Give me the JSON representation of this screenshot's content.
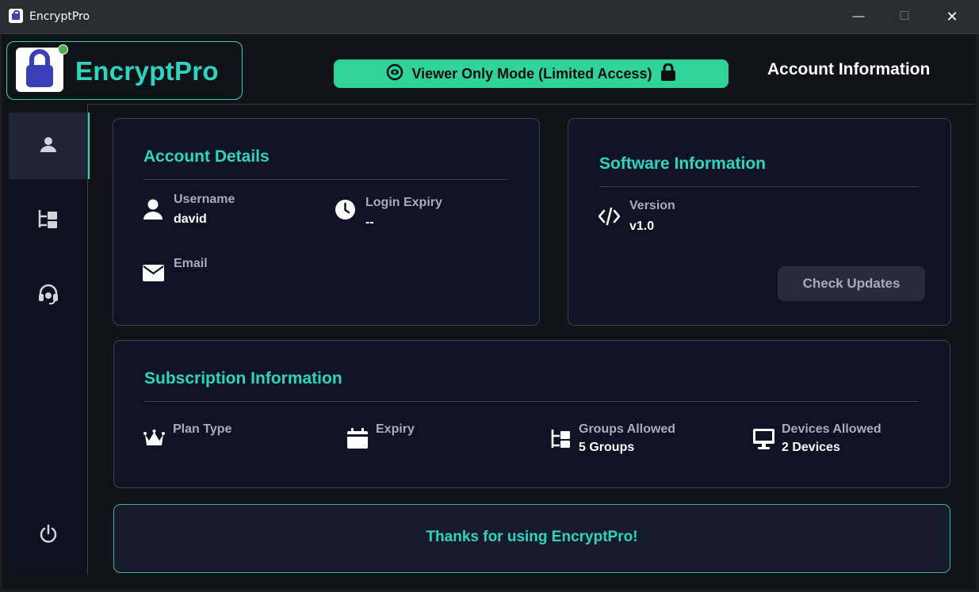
{
  "window": {
    "title": "EncryptPro",
    "minimize_glyph": "—",
    "maximize_glyph": "☐",
    "close_glyph": "✕"
  },
  "header": {
    "logo_text": "EncryptPro",
    "mode_banner": "Viewer Only Mode (Limited Access)",
    "page_heading": "Account Information"
  },
  "sidebar": {
    "items": [
      {
        "icon": "user-icon",
        "active": true
      },
      {
        "icon": "groups-icon",
        "active": false
      },
      {
        "icon": "support-headset-icon",
        "active": false
      }
    ],
    "bottom_icon": "power-icon"
  },
  "account_details": {
    "title": "Account Details",
    "username_label": "Username",
    "username_value": "david",
    "login_expiry_label": "Login Expiry",
    "login_expiry_value": "--",
    "email_label": "Email",
    "email_value": ""
  },
  "software_info": {
    "title": "Software Information",
    "version_label": "Version",
    "version_value": "v1.0",
    "check_updates_label": "Check Updates"
  },
  "subscription": {
    "title": "Subscription Information",
    "plan_label": "Plan Type",
    "plan_value": "",
    "expiry_label": "Expiry",
    "expiry_value": "",
    "groups_label": "Groups Allowed",
    "groups_value": "5 Groups",
    "devices_label": "Devices Allowed",
    "devices_value": "2 Devices"
  },
  "footer": {
    "thanks_text": "Thanks for using EncryptPro!"
  },
  "colors": {
    "accent": "#2dd4bf",
    "banner": "#2fd39a",
    "card_bg": "#0f1424",
    "status_dot": "#4caf50"
  }
}
